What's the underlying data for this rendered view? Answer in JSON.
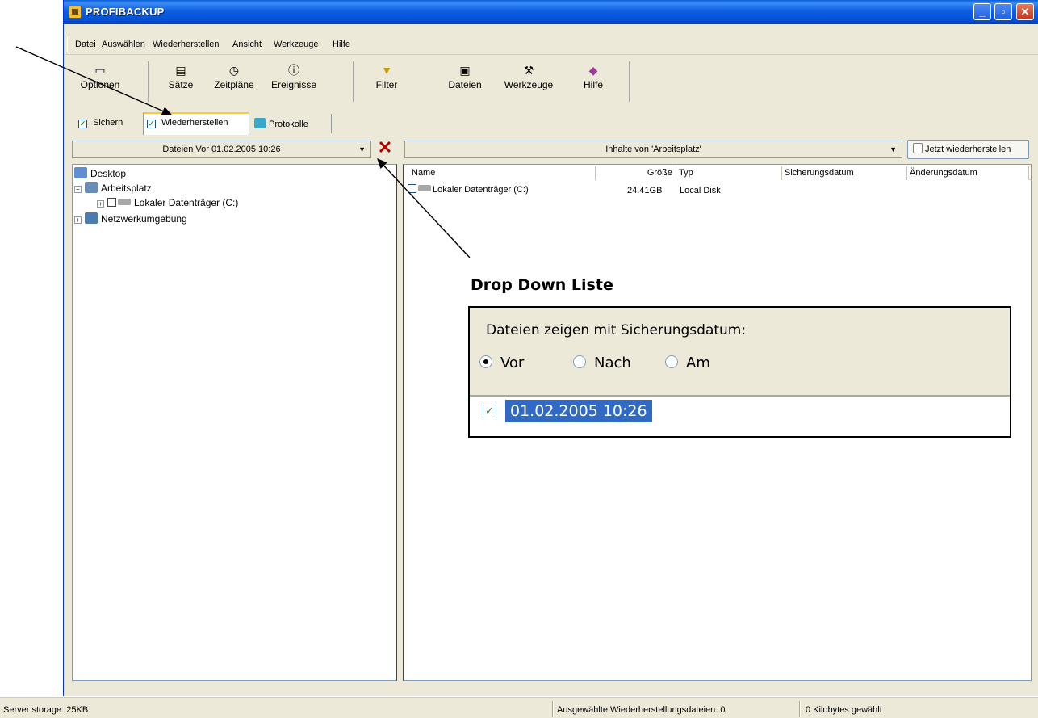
{
  "window": {
    "title": "PROFIBACKUP",
    "controls": {
      "minimize": "_",
      "maximize": "▫",
      "close": "✕"
    }
  },
  "menu": [
    "Datei",
    "Auswählen",
    "Wiederherstellen",
    "Ansicht",
    "Werkzeuge",
    "Hilfe"
  ],
  "toolbar": {
    "optionen": {
      "label": "Optionen",
      "icon": "options-icon"
    },
    "saetze": {
      "label": "Sätze",
      "icon": "sets-icon"
    },
    "zeitplaene": {
      "label": "Zeitpläne",
      "icon": "clock-icon"
    },
    "ereignisse": {
      "label": "Ereignisse",
      "icon": "info-icon"
    },
    "filter": {
      "label": "Filter",
      "icon": "funnel-icon"
    },
    "dateien": {
      "label": "Dateien",
      "icon": "file-icon"
    },
    "werkzeuge": {
      "label": "Werkzeuge",
      "icon": "tools-icon"
    },
    "hilfe": {
      "label": "Hilfe",
      "icon": "book-icon"
    }
  },
  "tabs": [
    {
      "label": "Sichern",
      "checked": true
    },
    {
      "label": "Wiederherstellen",
      "checked": true,
      "active": true
    },
    {
      "label": "Protokolle"
    }
  ],
  "left_combo": {
    "value": "Dateien Vor 01.02.2005 10:26"
  },
  "tree": {
    "desktop": "Desktop",
    "arbeitsplatz": "Arbeitsplatz",
    "lokaler": "Lokaler Datenträger (C:)",
    "netzwerk": "Netzwerkumgebung"
  },
  "right_combo": {
    "value": "Inhalte von 'Arbeitsplatz'"
  },
  "restore_button": "Jetzt wiederherstellen",
  "list": {
    "columns": [
      "Name",
      "Größe",
      "Typ",
      "Sicherungsdatum",
      "Änderungsdatum"
    ],
    "rows": [
      {
        "name": "Lokaler Datenträger (C:)",
        "size": "24.41GB",
        "type": "Local Disk",
        "backup_date": "",
        "modified_date": ""
      }
    ]
  },
  "status": {
    "storage": "Server storage: 25KB",
    "selected": "Ausgewählte Wiederherstellungsdateien: 0",
    "kilobytes": "0 Kilobytes gewählt"
  },
  "callout": {
    "label": "Drop Down Liste",
    "heading": "Dateien zeigen mit Sicherungsdatum:",
    "options": [
      "Vor",
      "Nach",
      "Am"
    ],
    "selected_option": "Vor",
    "date": "01.02.2005 10:26",
    "date_checked": true
  },
  "colors": {
    "titlebar": "#0552d8",
    "window_bg": "#ece9d8",
    "selection": "#316ac5",
    "close_x": "#b40000"
  }
}
